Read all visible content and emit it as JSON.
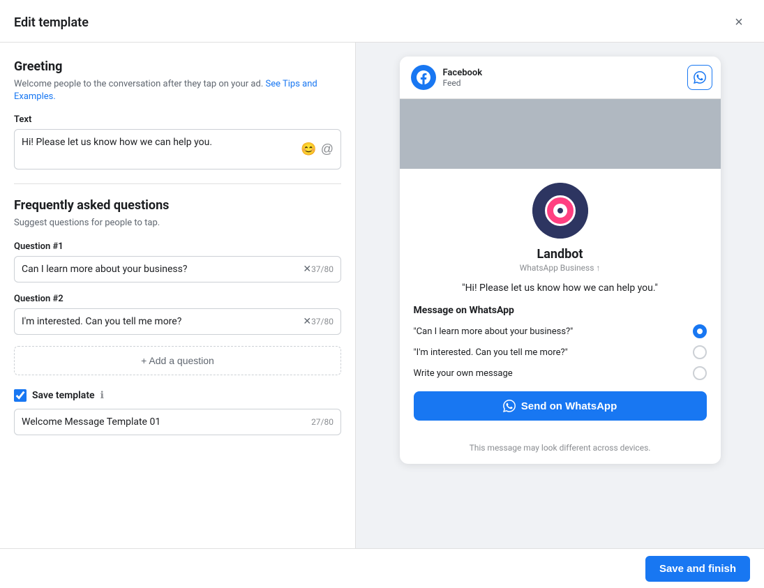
{
  "modal": {
    "title": "Edit template",
    "close_label": "×"
  },
  "left": {
    "greeting": {
      "section_title": "Greeting",
      "section_desc": "Welcome people to the conversation after they tap on your ad.",
      "see_tips_label": "See Tips and Examples.",
      "text_label": "Text",
      "text_value": "Hi! Please let us know how we can help you.",
      "emoji_icon": "😊",
      "mention_icon": "@"
    },
    "faq": {
      "section_title": "Frequently asked questions",
      "section_desc": "Suggest questions for people to tap.",
      "question1_label": "Question #1",
      "question1_value": "Can I learn more about your business?",
      "question1_chars": "37/80",
      "question2_label": "Question #2",
      "question2_value": "I'm interested. Can you tell me more?",
      "question2_chars": "37/80",
      "add_question_label": "+ Add a question"
    },
    "save_template": {
      "checkbox_label": "Save template",
      "template_name_value": "Welcome Message Template 01",
      "template_name_chars": "27/80"
    }
  },
  "right": {
    "preview": {
      "source_name": "Facebook",
      "source_sub": "Feed",
      "bot_name": "Landbot",
      "bot_subtitle": "WhatsApp Business ↑",
      "greeting_bubble": "\"Hi! Please let us know how we can help you.\"",
      "wa_section_title": "Message on WhatsApp",
      "options": [
        {
          "text": "\"Can I learn more about your business?\"",
          "selected": true
        },
        {
          "text": "\"I'm interested. Can you tell me more?\"",
          "selected": false
        },
        {
          "text": "Write your own message",
          "selected": false
        }
      ],
      "send_btn_label": "Send on WhatsApp",
      "disclaimer": "This message may look different across devices."
    }
  },
  "footer": {
    "save_finish_label": "Save and finish"
  }
}
